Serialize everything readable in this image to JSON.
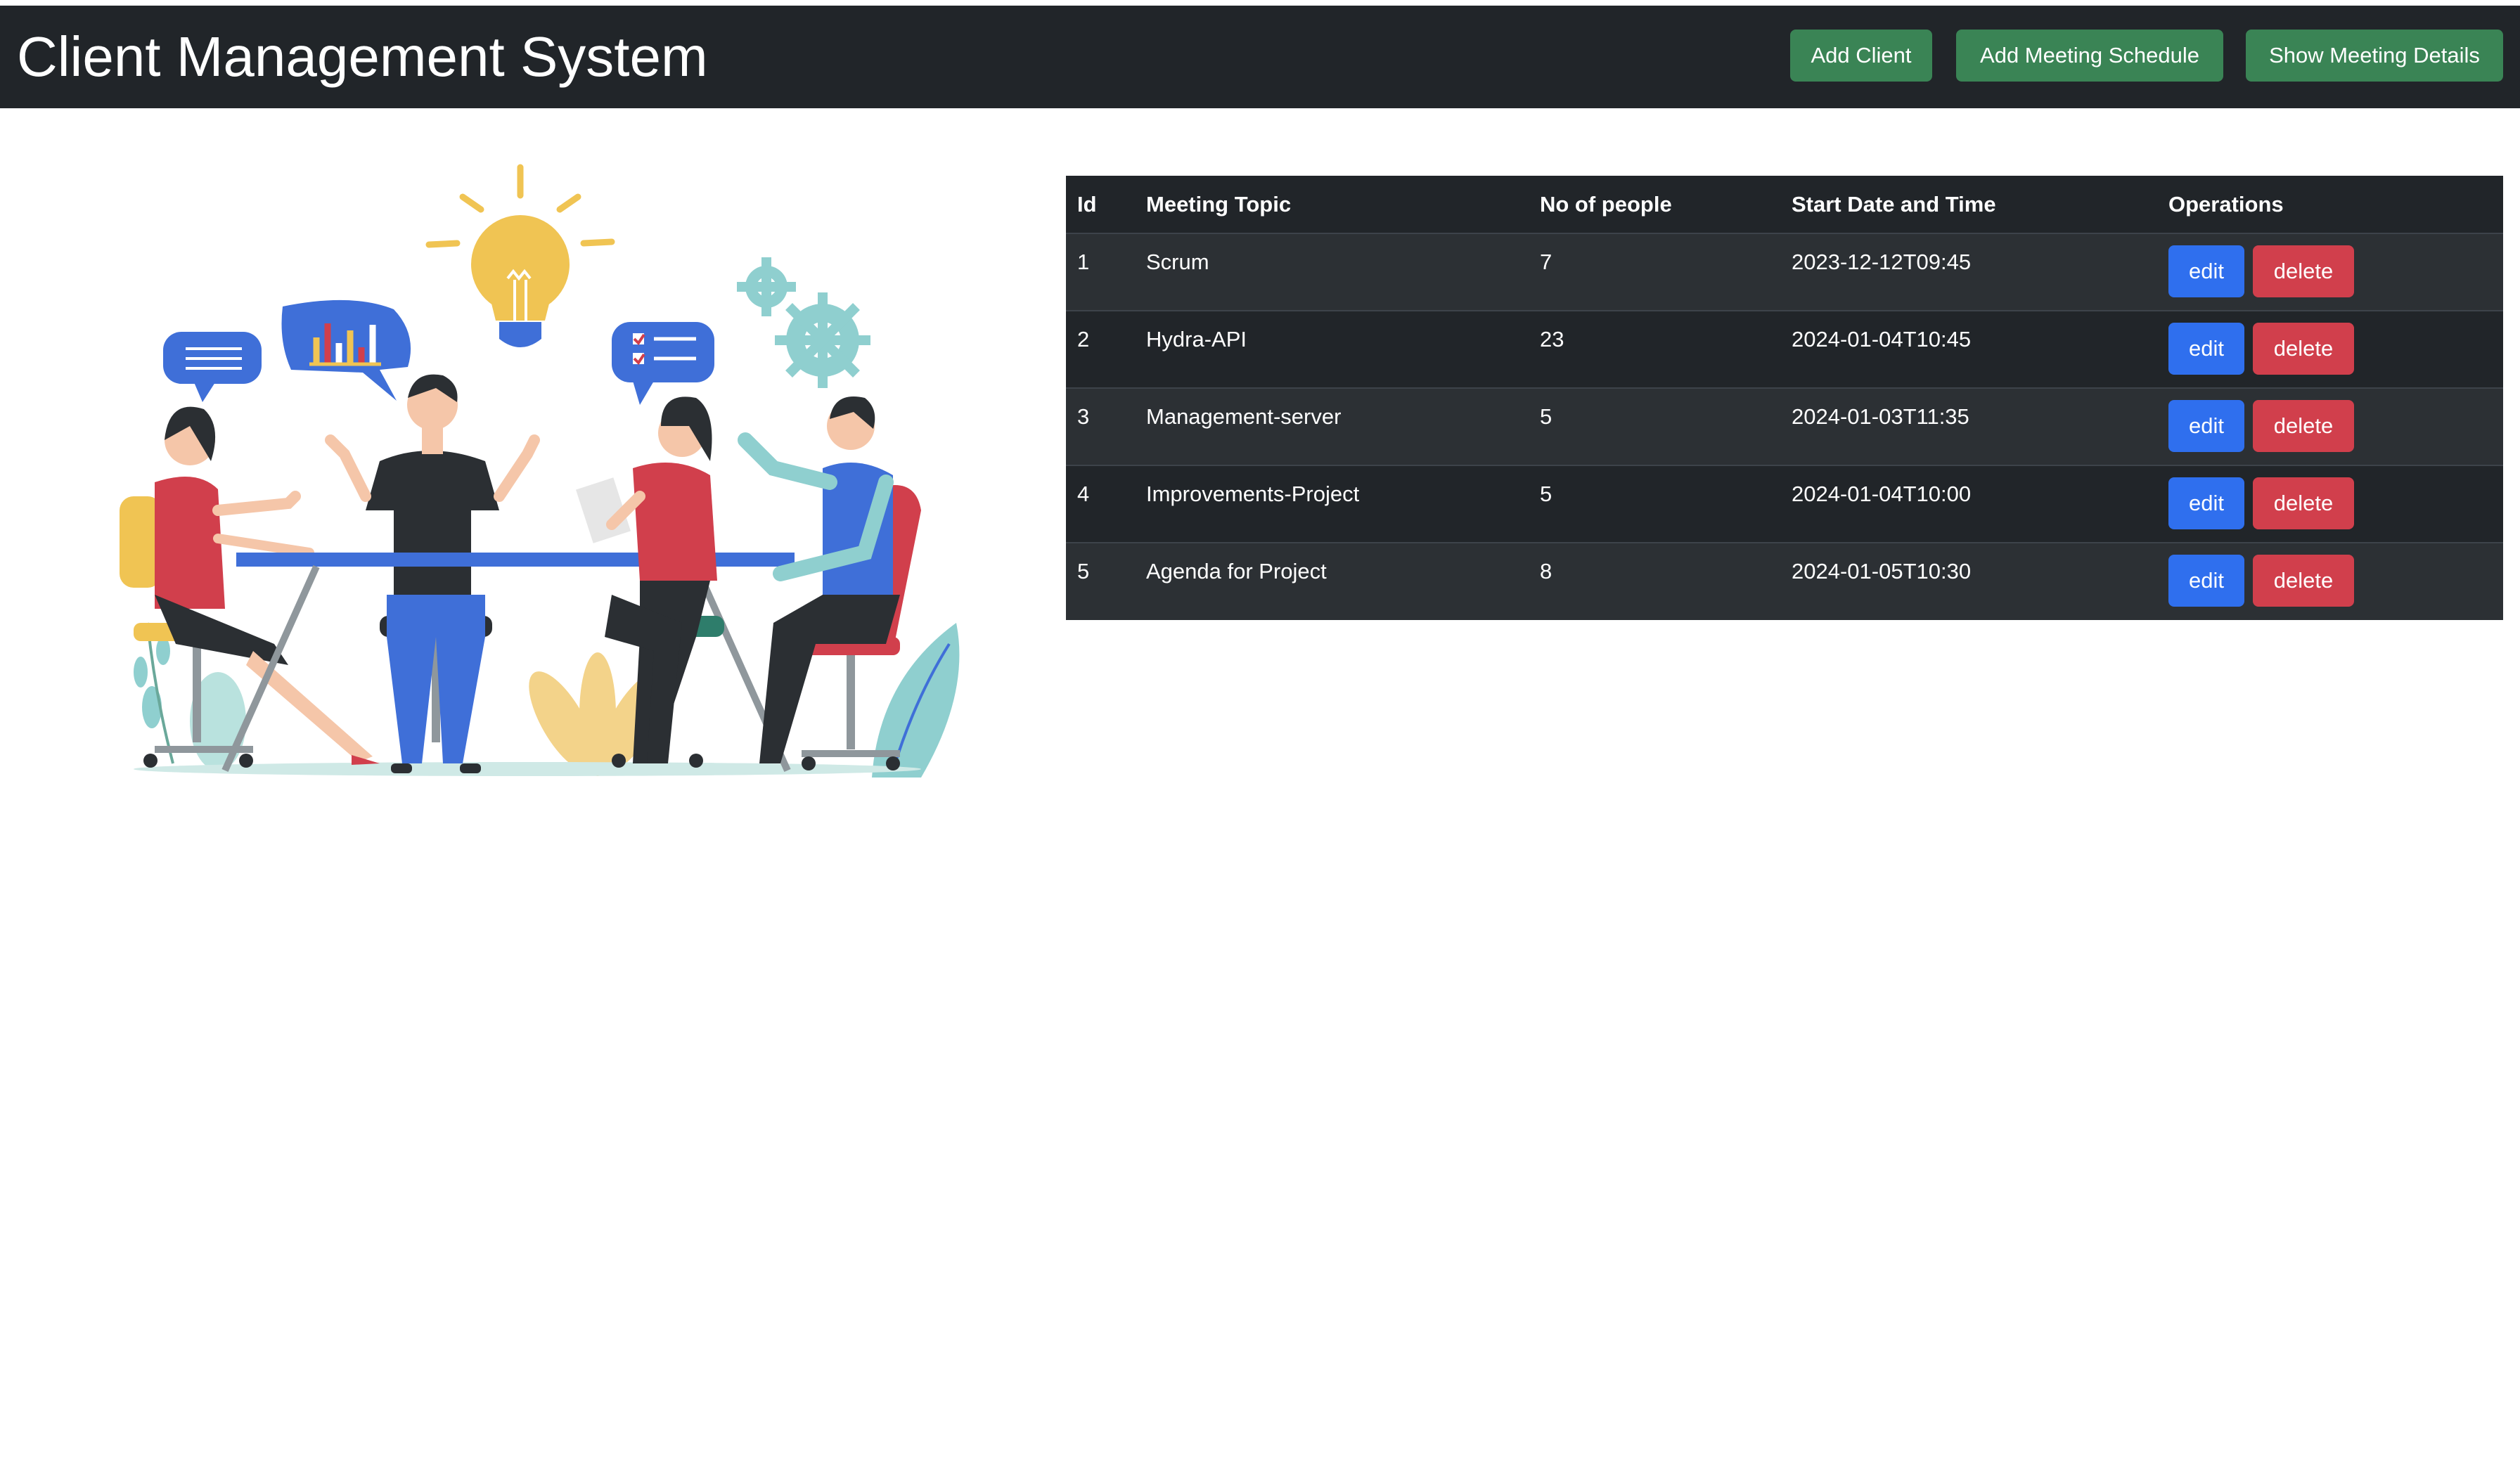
{
  "header": {
    "title": "Client Management System",
    "buttons": {
      "add_client": "Add Client",
      "add_meeting_schedule": "Add Meeting Schedule",
      "show_meeting_details": "Show Meeting Details"
    }
  },
  "colors": {
    "navbar": "#212529",
    "nav_button": "#3a8455",
    "edit_button": "#2f6fee",
    "delete_button": "#d13f4c"
  },
  "table": {
    "headers": [
      "Id",
      "Meeting Topic",
      "No of people",
      "Start Date and Time",
      "Operations"
    ],
    "rows": [
      {
        "id": "1",
        "topic": "Scrum",
        "people": "7",
        "start": "2023-12-12T09:45"
      },
      {
        "id": "2",
        "topic": "Hydra-API",
        "people": "23",
        "start": "2024-01-04T10:45"
      },
      {
        "id": "3",
        "topic": "Management-server",
        "people": "5",
        "start": "2024-01-03T11:35"
      },
      {
        "id": "4",
        "topic": "Improvements-Project",
        "people": "5",
        "start": "2024-01-04T10:00"
      },
      {
        "id": "5",
        "topic": "Agenda for Project",
        "people": "8",
        "start": "2024-01-05T10:30"
      }
    ],
    "edit_label": "edit",
    "delete_label": "delete"
  }
}
